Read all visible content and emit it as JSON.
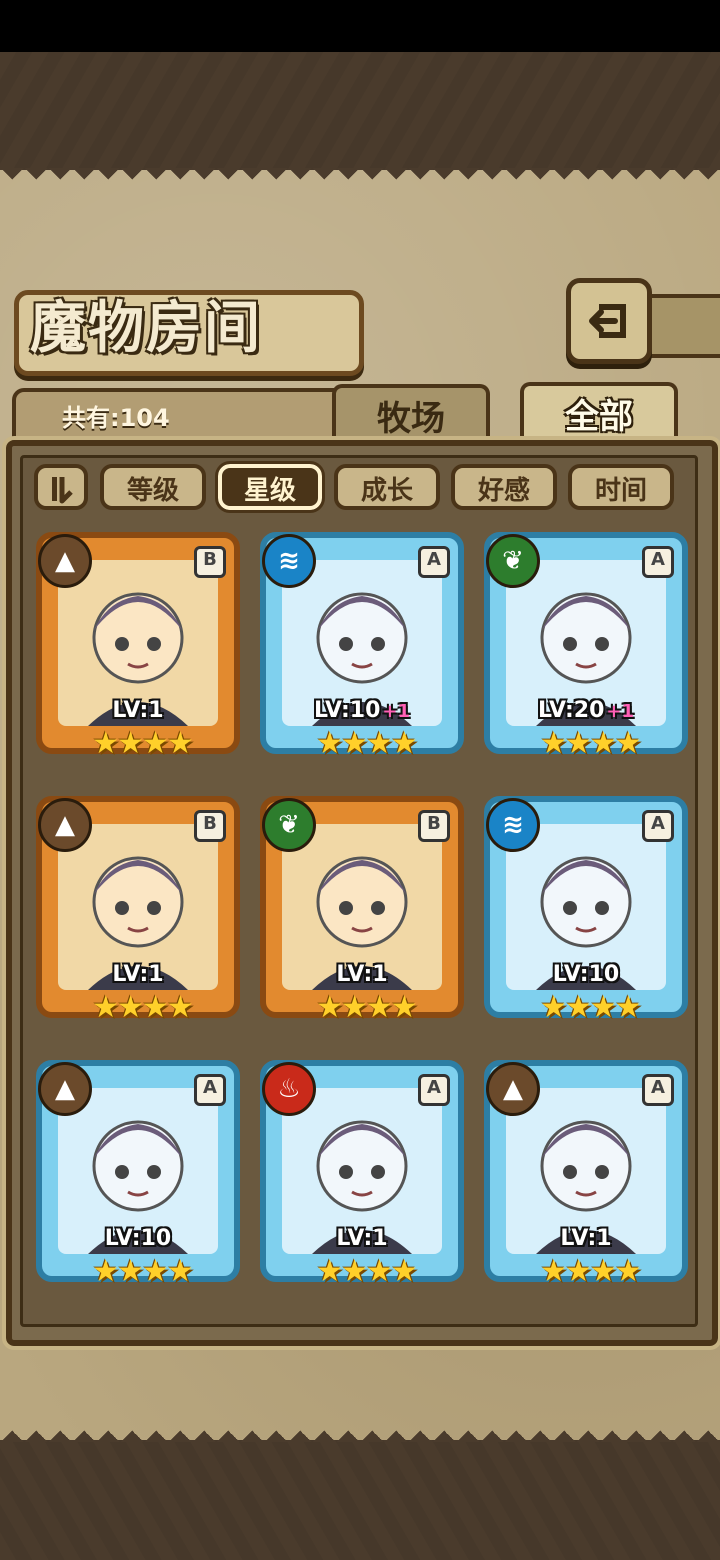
{
  "header": {
    "title": "魔物房间"
  },
  "summary": {
    "count_label": "共有:104"
  },
  "tabs": [
    {
      "label": "牧场"
    },
    {
      "label": "全部"
    }
  ],
  "filters": [
    {
      "label": "等级"
    },
    {
      "label": "星级"
    },
    {
      "label": "成长"
    },
    {
      "label": "好感"
    },
    {
      "label": "时间"
    }
  ],
  "cards": [
    {
      "rank": "B",
      "element": "earth",
      "level": "LV:1",
      "bonus": "",
      "stars": "★★★★"
    },
    {
      "rank": "A",
      "element": "water",
      "level": "LV:10",
      "bonus": "+1",
      "stars": "★★★★"
    },
    {
      "rank": "A",
      "element": "wood",
      "level": "LV:20",
      "bonus": "+1",
      "stars": "★★★★"
    },
    {
      "rank": "B",
      "element": "earth",
      "level": "LV:1",
      "bonus": "",
      "stars": "★★★★"
    },
    {
      "rank": "B",
      "element": "wood",
      "level": "LV:1",
      "bonus": "",
      "stars": "★★★★"
    },
    {
      "rank": "A",
      "element": "water",
      "level": "LV:10",
      "bonus": "",
      "stars": "★★★★"
    },
    {
      "rank": "A",
      "element": "earth",
      "level": "LV:10",
      "bonus": "",
      "stars": "★★★★"
    },
    {
      "rank": "A",
      "element": "fire",
      "level": "LV:1",
      "bonus": "",
      "stars": "★★★★"
    },
    {
      "rank": "A",
      "element": "earth",
      "level": "LV:1",
      "bonus": "",
      "stars": "★★★★"
    }
  ],
  "colors": {
    "earth": "#6b4a2b",
    "water": "#1a84c7",
    "wood": "#2d7d2d",
    "fire": "#c92a1a"
  }
}
